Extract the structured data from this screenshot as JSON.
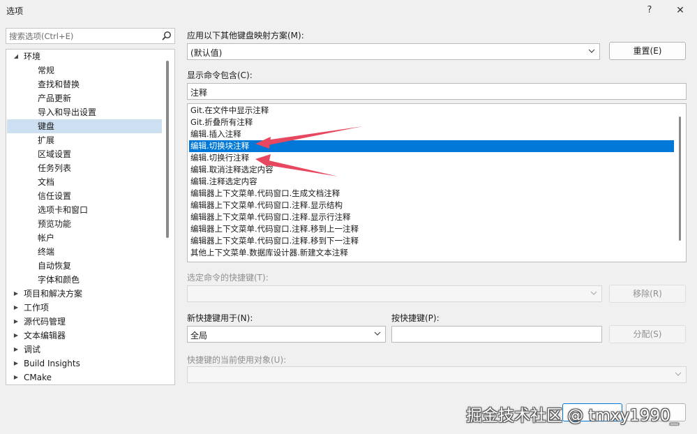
{
  "window": {
    "title": "选项",
    "help_glyph": "?",
    "close_glyph": "✕"
  },
  "search": {
    "placeholder": "搜索选项(Ctrl+E)"
  },
  "tree": {
    "items": [
      {
        "label": "环境",
        "expanded": true
      },
      {
        "label": "常规"
      },
      {
        "label": "查找和替换"
      },
      {
        "label": "产品更新"
      },
      {
        "label": "导入和导出设置"
      },
      {
        "label": "键盘",
        "selected": true
      },
      {
        "label": "扩展"
      },
      {
        "label": "区域设置"
      },
      {
        "label": "任务列表"
      },
      {
        "label": "文档"
      },
      {
        "label": "信任设置"
      },
      {
        "label": "选项卡和窗口"
      },
      {
        "label": "预览功能"
      },
      {
        "label": "帐户"
      },
      {
        "label": "终端"
      },
      {
        "label": "自动恢复"
      },
      {
        "label": "字体和颜色"
      },
      {
        "label": "项目和解决方案"
      },
      {
        "label": "工作项"
      },
      {
        "label": "源代码管理"
      },
      {
        "label": "文本编辑器"
      },
      {
        "label": "调试"
      },
      {
        "label": "Build Insights"
      },
      {
        "label": "CMake"
      }
    ]
  },
  "mapping": {
    "label": "应用以下其他键盘映射方案(M):",
    "value": "(默认值)",
    "reset_button": "重置(E)"
  },
  "filter": {
    "label": "显示命令包含(C):",
    "value": "注释"
  },
  "commands": {
    "items": [
      "Git.在文件中显示注释",
      "Git.折叠所有注释",
      "编辑.插入注释",
      "编辑.切换块注释",
      "编辑.切换行注释",
      "编辑.取消注释选定内容",
      "编辑.注释选定内容",
      "编辑器上下文菜单.代码窗口.生成文档注释",
      "编辑器上下文菜单.代码窗口.注释.显示结构",
      "编辑器上下文菜单.代码窗口.注释.显示行注释",
      "编辑器上下文菜单.代码窗口.注释.移到上一注释",
      "编辑器上下文菜单.代码窗口.注释.移到下一注释",
      "其他上下文菜单.数据库设计器.新建文本注释"
    ],
    "selected_index": 3
  },
  "shortcuts": {
    "label": "选定命令的快捷键(T):",
    "remove_button": "移除(R)"
  },
  "new_shortcut": {
    "scope_label": "新快捷键用于(N):",
    "scope_value": "全局",
    "keys_label": "按快捷键(P):",
    "keys_value": "",
    "assign_button": "分配(S)"
  },
  "usage": {
    "label": "快捷键的当前使用对象(U):"
  },
  "watermark": {
    "text": "掘金技术社区 @ tmxy1990_"
  },
  "colors": {
    "selection": "#0078d7",
    "tree_selection": "#cde0f2",
    "annotation_arrow": "#e8485f"
  }
}
